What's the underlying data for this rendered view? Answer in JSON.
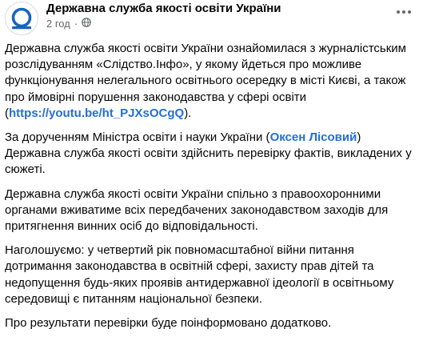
{
  "post": {
    "page_name": "Державна служба якості освіти України",
    "time": "2 год",
    "separator": "·",
    "icons": {
      "avatar": "page-logo-icon",
      "privacy": "globe-icon",
      "menu": "more-options-icon"
    },
    "colors": {
      "link": "#216fdb",
      "meta": "#65676b",
      "logo": "#1565c0"
    },
    "paragraphs": {
      "p1": {
        "before": "Державна служба якості освіти України ознайомилася з журналістським розслідуванням «Слідство.Інфо», у якому йдеться про можливе функціонування нелегального освітнього осередку в місті Києві, а також про ймовірні порушення законодавства у сфері освіти (",
        "link": "https://youtu.be/ht_PJXsOCgQ",
        "after": ")."
      },
      "p2": {
        "before": "За дорученням Міністра освіти і науки України (",
        "mention": "Оксен Лісовий",
        "after": ") Державна служба якості освіти здійснить перевірку фактів, викладених у сюжеті."
      },
      "p3": "Державна служба якості освіти України спільно з правоохоронними органами вживатиме всіх передбачених законодавством заходів для притягнення винних осіб до відповідальності.",
      "p4": "Наголошуємо: у четвертий рік повномасштабної війни питання дотримання законодавства в освітній сфері, захисту прав дітей та недопущення будь-яких проявів антидержавної ідеології в освітньому середовищі є питанням національної безпеки.",
      "p5": "Про результати перевірки буде поінформовано додатково."
    }
  }
}
